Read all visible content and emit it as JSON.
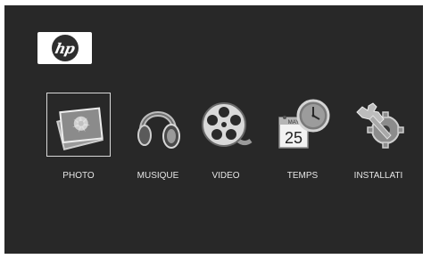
{
  "brand": {
    "logo_text": "hp",
    "logo_icon": "hp-logo"
  },
  "menu": {
    "items": [
      {
        "label": "PHOTO",
        "icon": "photo-icon",
        "selected": true
      },
      {
        "label": "MUSIQUE",
        "icon": "headphones-icon",
        "selected": false
      },
      {
        "label": "VIDÉO",
        "icon": "film-reel-icon",
        "selected": false
      },
      {
        "label": "TEMPS",
        "icon": "calendar-clock-icon",
        "selected": false
      },
      {
        "label": "INSTALLATI",
        "icon": "wrench-gear-icon",
        "selected": false
      }
    ]
  },
  "calendar_icon": {
    "month": "MAY",
    "day": "25"
  },
  "colors": {
    "screen_background": "#282828",
    "label_text": "#e6e6e6",
    "selection_border": "#d8d8d8"
  }
}
